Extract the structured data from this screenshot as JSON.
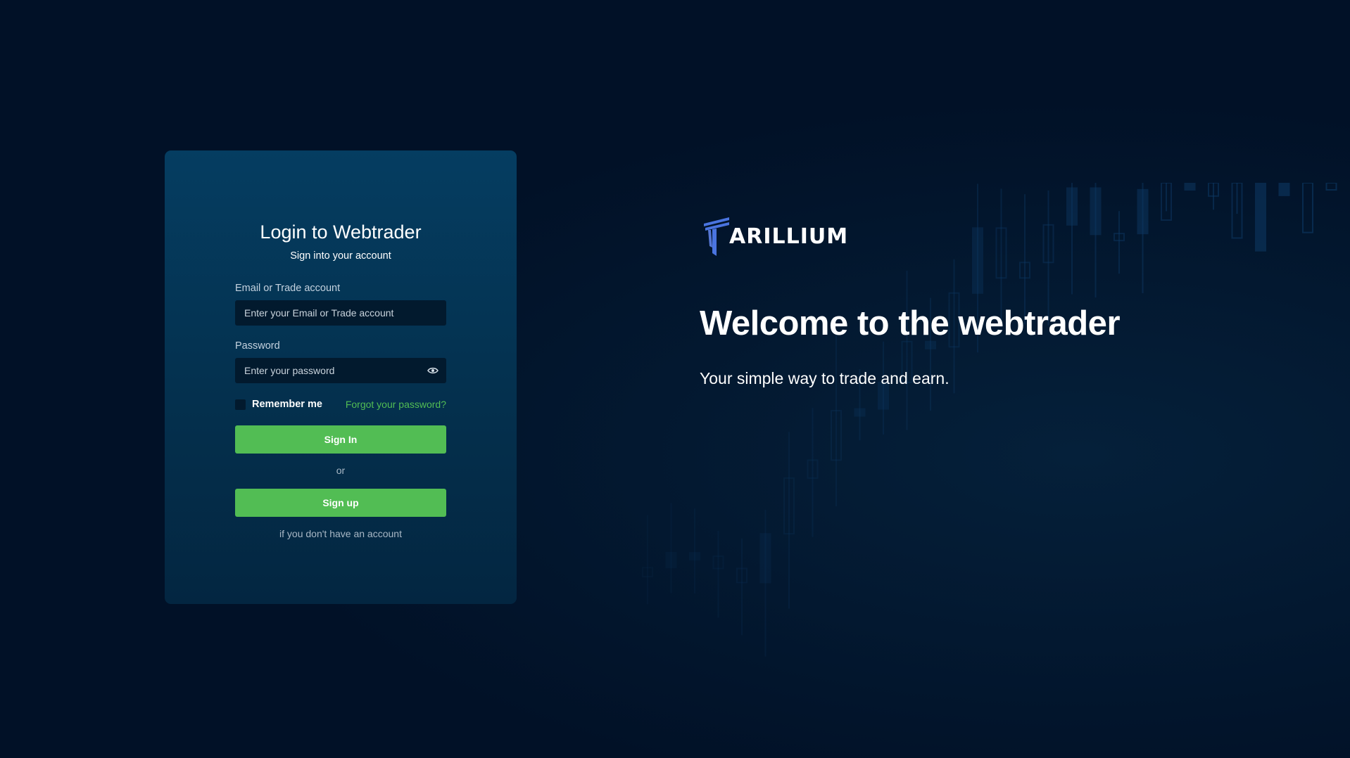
{
  "login": {
    "title": "Login to Webtrader",
    "subtitle": "Sign into your account",
    "email_label": "Email or Trade account",
    "email_placeholder": "Enter your Email or Trade account",
    "email_value": "",
    "password_label": "Password",
    "password_placeholder": "Enter your password",
    "password_value": "",
    "remember_label": "Remember me",
    "remember_checked": false,
    "forgot_label": "Forgot your password?",
    "signin_label": "Sign In",
    "or_label": "or",
    "signup_label": "Sign up",
    "signup_hint": "if you don't have an account"
  },
  "brand": {
    "logo_text": "ARILLIUM",
    "logo_icon": "tarillium-logo-icon"
  },
  "hero": {
    "headline": "Welcome to the webtrader",
    "tagline": "Your simple way to trade and earn."
  },
  "colors": {
    "background": "#011127",
    "card": "#053d61",
    "accent_green": "#52bd54",
    "logo_blue": "#4a74e0",
    "input_bg": "#021a2e"
  }
}
